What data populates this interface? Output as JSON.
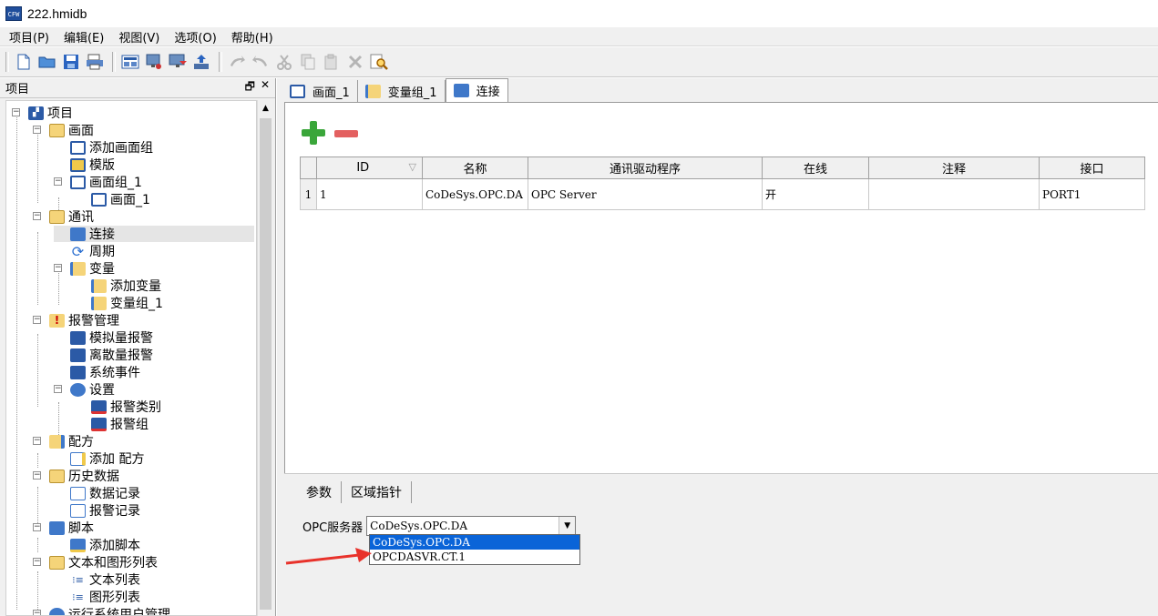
{
  "window": {
    "title": "222.hmidb",
    "app_icon_text": "CFW"
  },
  "menu": {
    "items": [
      "项目(P)",
      "编辑(E)",
      "视图(V)",
      "选项(O)",
      "帮助(H)"
    ]
  },
  "left_panel": {
    "title": "项目",
    "restore_glyph": "🗗",
    "close_glyph": "✕"
  },
  "tree": {
    "nodes": [
      {
        "label": "项目",
        "icon": "factory-icon"
      },
      {
        "label": "画面",
        "icon": "folder-screens-icon"
      },
      {
        "label": "添加画面组",
        "icon": "add-screen-group-icon"
      },
      {
        "label": "模版",
        "icon": "template-icon"
      },
      {
        "label": "画面组_1",
        "icon": "screen-group-icon"
      },
      {
        "label": "画面_1",
        "icon": "screen-icon"
      },
      {
        "label": "通讯",
        "icon": "communication-folder-icon"
      },
      {
        "label": "连接",
        "icon": "connection-icon"
      },
      {
        "label": "周期",
        "icon": "cycle-icon"
      },
      {
        "label": "变量",
        "icon": "variable-icon"
      },
      {
        "label": "添加变量",
        "icon": "add-variable-icon"
      },
      {
        "label": "变量组_1",
        "icon": "variable-group-icon"
      },
      {
        "label": "报警管理",
        "icon": "alarm-folder-icon"
      },
      {
        "label": "模拟量报警",
        "icon": "analog-alarm-icon"
      },
      {
        "label": "离散量报警",
        "icon": "discrete-alarm-icon"
      },
      {
        "label": "系统事件",
        "icon": "system-event-icon"
      },
      {
        "label": "设置",
        "icon": "settings-icon"
      },
      {
        "label": "报警类别",
        "icon": "alarm-class-icon"
      },
      {
        "label": "报警组",
        "icon": "alarm-group-icon"
      },
      {
        "label": "配方",
        "icon": "recipe-folder-icon"
      },
      {
        "label": "添加 配方",
        "icon": "add-recipe-icon"
      },
      {
        "label": "历史数据",
        "icon": "history-folder-icon"
      },
      {
        "label": "数据记录",
        "icon": "data-log-icon"
      },
      {
        "label": "报警记录",
        "icon": "alarm-log-icon"
      },
      {
        "label": "脚本",
        "icon": "script-folder-icon"
      },
      {
        "label": "添加脚本",
        "icon": "add-script-icon"
      },
      {
        "label": "文本和图形列表",
        "icon": "text-graphic-folder-icon"
      },
      {
        "label": "文本列表",
        "icon": "text-list-icon"
      },
      {
        "label": "图形列表",
        "icon": "graphic-list-icon"
      },
      {
        "label": "运行系统用户管理",
        "icon": "user-admin-icon"
      }
    ]
  },
  "doc_tabs": [
    {
      "label": "画面_1",
      "icon": "screen-icon"
    },
    {
      "label": "变量组_1",
      "icon": "variable-group-icon"
    },
    {
      "label": "连接",
      "icon": "connection-icon"
    }
  ],
  "table": {
    "headers": [
      "ID",
      "名称",
      "通讯驱动程序",
      "在线",
      "注释",
      "接口"
    ],
    "rows": [
      {
        "row_no": "1",
        "id": "1",
        "name": "CoDeSys.OPC.DA",
        "driver": "OPC Server",
        "online": "开",
        "comment": "",
        "port": "PORT1"
      }
    ],
    "sort_glyph": "▽"
  },
  "props": {
    "tabs": [
      "参数",
      "区域指针"
    ],
    "opc_label": "OPC服务器",
    "opc_value": "CoDeSys.OPC.DA",
    "options": [
      "CoDeSys.OPC.DA",
      "OPCDASVR.CT.1"
    ]
  },
  "colors": {
    "accent_highlight": "#0a64d8",
    "add_green": "#3aa63a",
    "remove_red": "#e36060",
    "annotation_arrow": "#e8322b"
  }
}
